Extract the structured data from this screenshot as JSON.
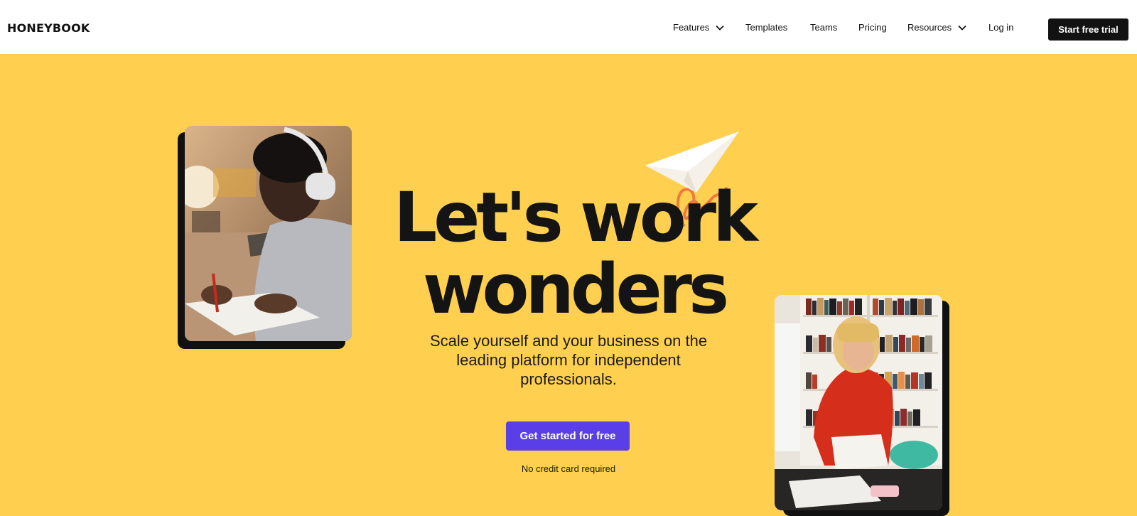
{
  "brand": {
    "logo_text": "HONEYBOOK"
  },
  "nav": {
    "items": [
      {
        "label": "Features",
        "has_dropdown": true
      },
      {
        "label": "Templates",
        "has_dropdown": false
      },
      {
        "label": "Teams",
        "has_dropdown": false
      },
      {
        "label": "Pricing",
        "has_dropdown": false
      },
      {
        "label": "Resources",
        "has_dropdown": true
      },
      {
        "label": "Log in",
        "has_dropdown": false
      }
    ],
    "cta_label": "Start free trial"
  },
  "hero": {
    "headline_line1": "Let's work",
    "headline_line2": "wonders",
    "subtitle": "Scale yourself and your business on the leading platform for independent professionals.",
    "cta_label": "Get started for free",
    "note": "No credit card required"
  },
  "icons": {
    "chevron": "chevron-down-icon",
    "plane": "paper-plane-icon"
  },
  "colors": {
    "hero_background": "#ffd04f",
    "primary_cta": "#5a3ee8",
    "dark": "#121212",
    "accent_orange": "#f07a3c"
  }
}
